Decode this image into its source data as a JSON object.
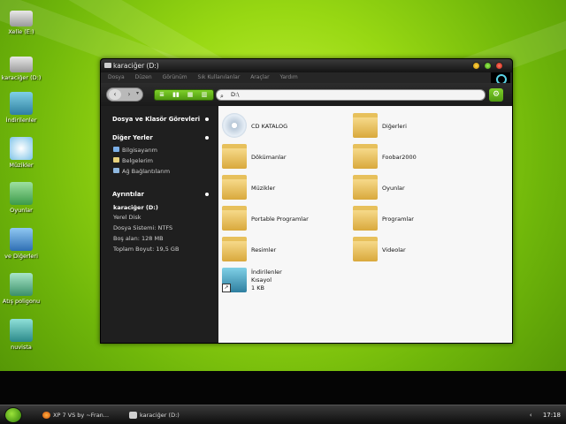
{
  "desktop_icons": [
    {
      "label": "Xelle (E:)",
      "icon": "drive-icon"
    },
    {
      "label": "karaciğer (D:)",
      "icon": "drive-icon"
    },
    {
      "label": "İndirilenler",
      "icon": "downloads-shortcut-icon"
    },
    {
      "label": "Müzikler",
      "icon": "music-shortcut-icon"
    },
    {
      "label": "Oyunlar",
      "icon": "games-shortcut-icon"
    },
    {
      "label": "ve Diğerleri",
      "icon": "folder-shortcut-icon"
    },
    {
      "label": "Atış poligonu",
      "icon": "shortcut-icon"
    },
    {
      "label": "nuvista",
      "icon": "shortcut-icon"
    }
  ],
  "window": {
    "title": "karaciğer (D:)",
    "menu": [
      "Dosya",
      "Düzen",
      "Görünüm",
      "Sık Kullanılanlar",
      "Araçlar",
      "Yardım"
    ],
    "address": "D:\\",
    "view_buttons": [
      "≣",
      "▮▮",
      "▦",
      "▥"
    ]
  },
  "sidepanel": {
    "tasks_title": "Dosya ve Klasör Görevleri",
    "places_title": "Diğer Yerler",
    "places": [
      "Bilgisayarım",
      "Belgelerim",
      "Ağ Bağlantılarım"
    ],
    "details_title": "Ayrıntılar",
    "details": [
      "karaciğer (D:)",
      "Yerel Disk",
      "Dosya Sistemi: NTFS",
      "Boş alan: 128 MB",
      "Toplam Boyut: 19,5 GB"
    ]
  },
  "files": [
    {
      "name": "CD KATALOG",
      "type": "cd"
    },
    {
      "name": "Diğerleri",
      "type": "folder"
    },
    {
      "name": "Dökümanlar",
      "type": "folder"
    },
    {
      "name": "Foobar2000",
      "type": "folder"
    },
    {
      "name": "Müzikler",
      "type": "folder"
    },
    {
      "name": "Oyunlar",
      "type": "folder"
    },
    {
      "name": "Portable Programlar",
      "type": "folder"
    },
    {
      "name": "Programlar",
      "type": "folder"
    },
    {
      "name": "Resimler",
      "type": "folder"
    },
    {
      "name": "Videolar",
      "type": "folder"
    }
  ],
  "shortcut_file": {
    "name": "İndirilenler",
    "line2": "Kısayol",
    "line3": "1 KB"
  },
  "taskbar": {
    "tasks": [
      "XP 7 VS by ~Fran...",
      "karaciğer (D:)"
    ],
    "clock": "17:18",
    "tray_arrow": "‹"
  },
  "colors": {
    "accent_green": "#6fb60a",
    "window_dark": "#1b1b1b"
  }
}
